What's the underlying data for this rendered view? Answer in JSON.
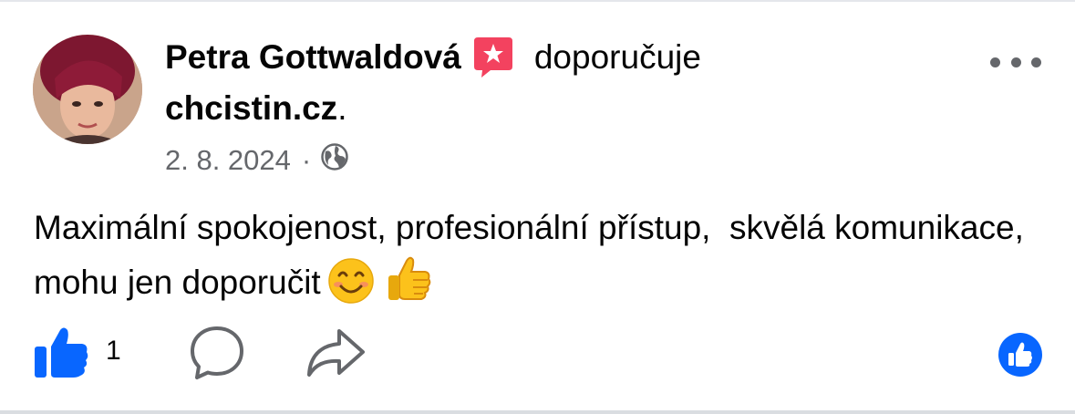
{
  "post": {
    "author": "Petra Gottwaldová",
    "verb": "doporučuje",
    "page_name": "chcistin.cz",
    "page_suffix": ".",
    "date": "2. 8. 2024",
    "separator": "·",
    "audience_icon": "globe-icon",
    "text": "Maximální spokojenost, profesionální přístup,  skvělá komunikace, mohu jen doporučit",
    "emojis": [
      "smiling-face-emoji",
      "thumbs-up-emoji"
    ]
  },
  "actions": {
    "like_count": "1",
    "icons": [
      "like-icon",
      "comment-icon",
      "share-icon",
      "like-reaction-icon"
    ]
  },
  "colors": {
    "accent_blue": "#0866ff",
    "recommend_red": "#f3425f",
    "secondary_text": "#65676b"
  }
}
